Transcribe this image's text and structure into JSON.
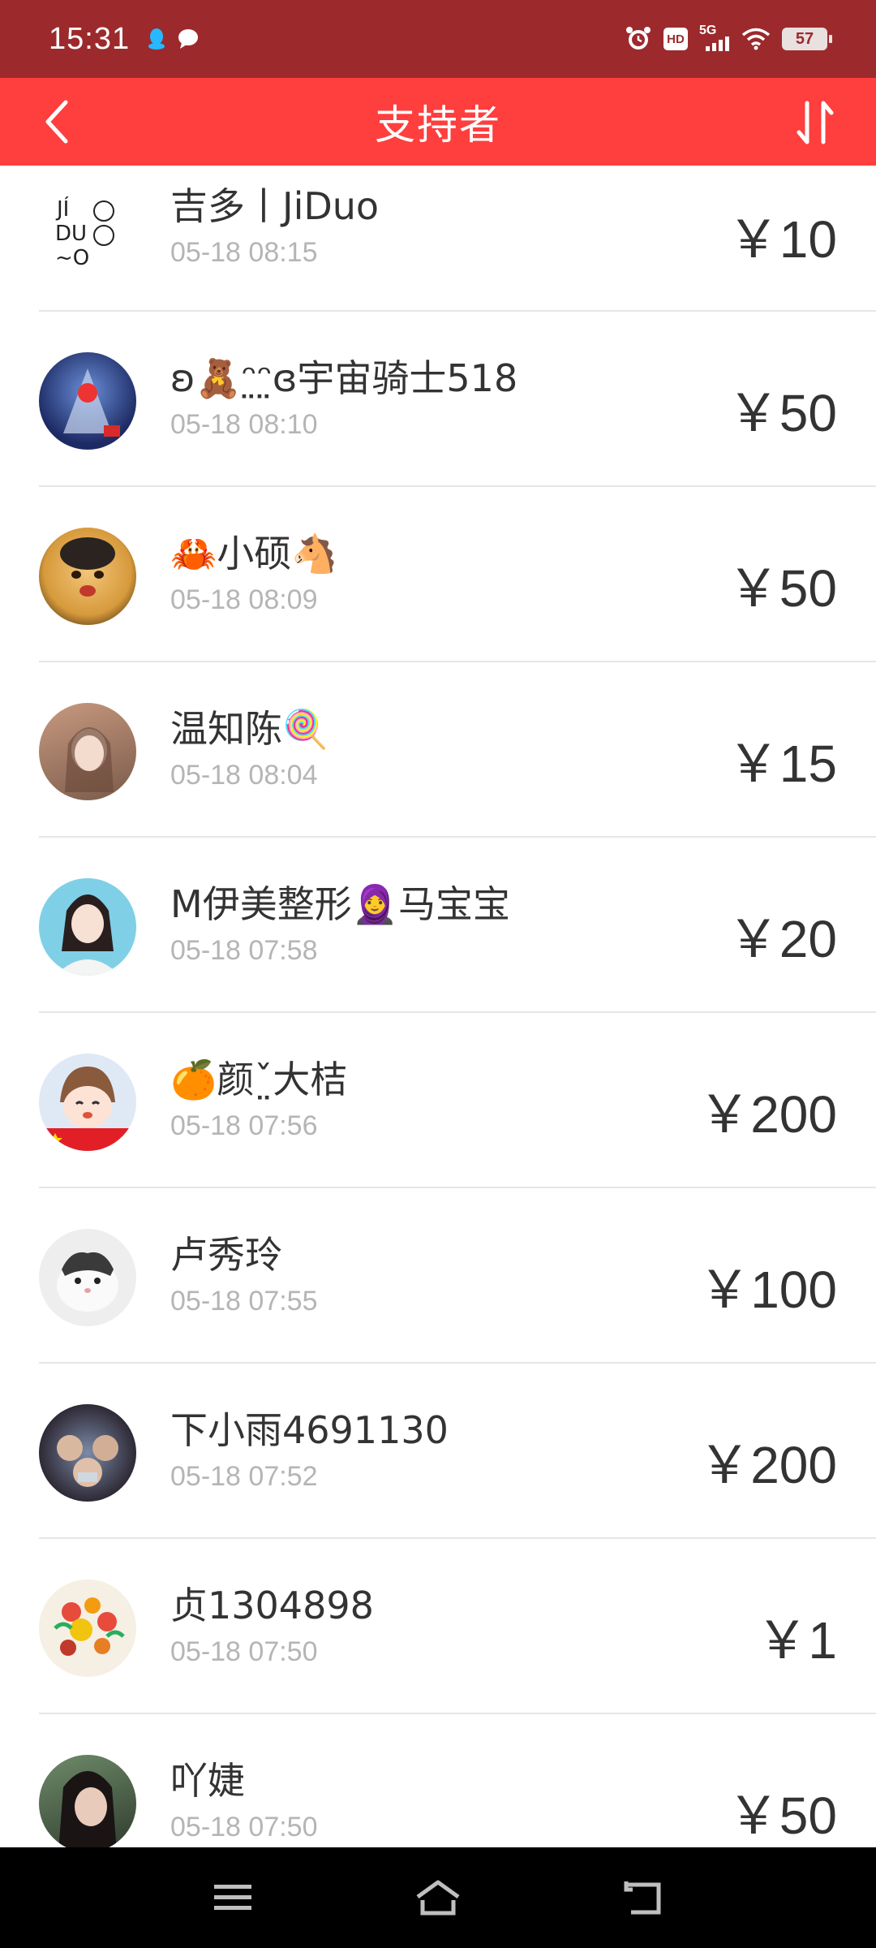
{
  "status_bar": {
    "time": "15:31",
    "left_icons": [
      "qq-icon",
      "message-icon"
    ],
    "right_icons": [
      "alarm-icon",
      "hd-icon",
      "5g-signal-icon",
      "wifi-icon",
      "battery-icon"
    ],
    "hd_label": "HD",
    "network_label": "5G",
    "battery_level": "57"
  },
  "header": {
    "title": "支持者",
    "back_icon": "back-chevron-icon",
    "sort_icon": "sort-icon"
  },
  "colors": {
    "status_bar_bg": "#9c2a2d",
    "header_bg": "#ff3e3e",
    "name_text": "#333333",
    "time_text": "#b5b5b5",
    "divider": "#e6e6e6"
  },
  "supporters": [
    {
      "name": "吉多丨JiDuo",
      "time": "05-18 08:15",
      "amount": "￥10"
    },
    {
      "name": "ʚ🧸ᵔ̤ᵔ̤ɞ宇宙骑士518",
      "time": "05-18 08:10",
      "amount": "￥50"
    },
    {
      "name": "🦀小硕🐴",
      "time": "05-18 08:09",
      "amount": "￥50"
    },
    {
      "name": "温知陈🍭",
      "time": "05-18 08:04",
      "amount": "￥15"
    },
    {
      "name": "M伊美整形🧕马宝宝",
      "time": "05-18 07:58",
      "amount": "￥20"
    },
    {
      "name": "🍊颜ˇ̤大桔",
      "time": "05-18 07:56",
      "amount": "￥200"
    },
    {
      "name": "卢秀玲",
      "time": "05-18 07:55",
      "amount": "￥100"
    },
    {
      "name": "下小雨4691130",
      "time": "05-18 07:52",
      "amount": "￥200"
    },
    {
      "name": "贞1304898",
      "time": "05-18 07:50",
      "amount": "￥1"
    },
    {
      "name": "吖婕",
      "time": "05-18 07:50",
      "amount": "￥50"
    }
  ],
  "nav_bar": {
    "icons": [
      "menu-icon",
      "home-icon",
      "back-icon"
    ]
  }
}
